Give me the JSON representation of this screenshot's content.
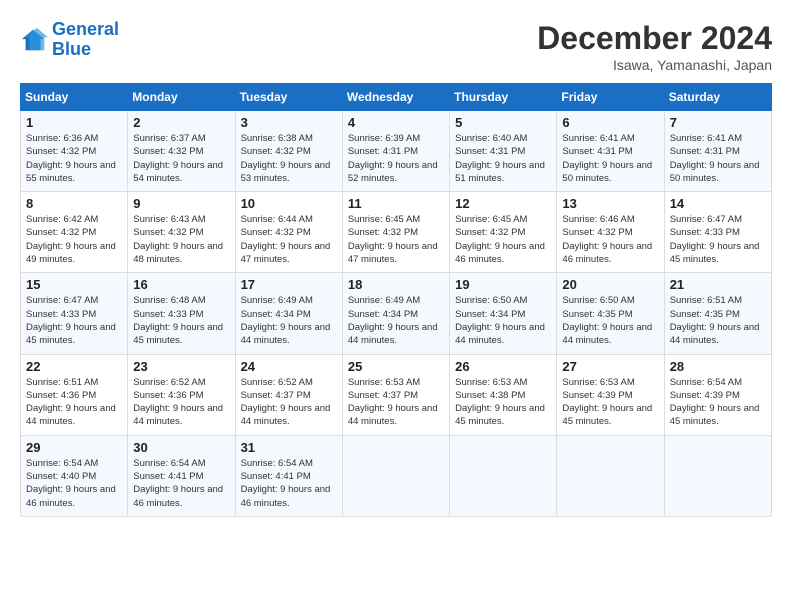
{
  "header": {
    "logo_line1": "General",
    "logo_line2": "Blue",
    "month": "December 2024",
    "location": "Isawa, Yamanashi, Japan"
  },
  "weekdays": [
    "Sunday",
    "Monday",
    "Tuesday",
    "Wednesday",
    "Thursday",
    "Friday",
    "Saturday"
  ],
  "weeks": [
    [
      {
        "day": "1",
        "sunrise": "6:36 AM",
        "sunset": "4:32 PM",
        "daylight": "9 hours and 55 minutes."
      },
      {
        "day": "2",
        "sunrise": "6:37 AM",
        "sunset": "4:32 PM",
        "daylight": "9 hours and 54 minutes."
      },
      {
        "day": "3",
        "sunrise": "6:38 AM",
        "sunset": "4:32 PM",
        "daylight": "9 hours and 53 minutes."
      },
      {
        "day": "4",
        "sunrise": "6:39 AM",
        "sunset": "4:31 PM",
        "daylight": "9 hours and 52 minutes."
      },
      {
        "day": "5",
        "sunrise": "6:40 AM",
        "sunset": "4:31 PM",
        "daylight": "9 hours and 51 minutes."
      },
      {
        "day": "6",
        "sunrise": "6:41 AM",
        "sunset": "4:31 PM",
        "daylight": "9 hours and 50 minutes."
      },
      {
        "day": "7",
        "sunrise": "6:41 AM",
        "sunset": "4:31 PM",
        "daylight": "9 hours and 50 minutes."
      }
    ],
    [
      {
        "day": "8",
        "sunrise": "6:42 AM",
        "sunset": "4:32 PM",
        "daylight": "9 hours and 49 minutes."
      },
      {
        "day": "9",
        "sunrise": "6:43 AM",
        "sunset": "4:32 PM",
        "daylight": "9 hours and 48 minutes."
      },
      {
        "day": "10",
        "sunrise": "6:44 AM",
        "sunset": "4:32 PM",
        "daylight": "9 hours and 47 minutes."
      },
      {
        "day": "11",
        "sunrise": "6:45 AM",
        "sunset": "4:32 PM",
        "daylight": "9 hours and 47 minutes."
      },
      {
        "day": "12",
        "sunrise": "6:45 AM",
        "sunset": "4:32 PM",
        "daylight": "9 hours and 46 minutes."
      },
      {
        "day": "13",
        "sunrise": "6:46 AM",
        "sunset": "4:32 PM",
        "daylight": "9 hours and 46 minutes."
      },
      {
        "day": "14",
        "sunrise": "6:47 AM",
        "sunset": "4:33 PM",
        "daylight": "9 hours and 45 minutes."
      }
    ],
    [
      {
        "day": "15",
        "sunrise": "6:47 AM",
        "sunset": "4:33 PM",
        "daylight": "9 hours and 45 minutes."
      },
      {
        "day": "16",
        "sunrise": "6:48 AM",
        "sunset": "4:33 PM",
        "daylight": "9 hours and 45 minutes."
      },
      {
        "day": "17",
        "sunrise": "6:49 AM",
        "sunset": "4:34 PM",
        "daylight": "9 hours and 44 minutes."
      },
      {
        "day": "18",
        "sunrise": "6:49 AM",
        "sunset": "4:34 PM",
        "daylight": "9 hours and 44 minutes."
      },
      {
        "day": "19",
        "sunrise": "6:50 AM",
        "sunset": "4:34 PM",
        "daylight": "9 hours and 44 minutes."
      },
      {
        "day": "20",
        "sunrise": "6:50 AM",
        "sunset": "4:35 PM",
        "daylight": "9 hours and 44 minutes."
      },
      {
        "day": "21",
        "sunrise": "6:51 AM",
        "sunset": "4:35 PM",
        "daylight": "9 hours and 44 minutes."
      }
    ],
    [
      {
        "day": "22",
        "sunrise": "6:51 AM",
        "sunset": "4:36 PM",
        "daylight": "9 hours and 44 minutes."
      },
      {
        "day": "23",
        "sunrise": "6:52 AM",
        "sunset": "4:36 PM",
        "daylight": "9 hours and 44 minutes."
      },
      {
        "day": "24",
        "sunrise": "6:52 AM",
        "sunset": "4:37 PM",
        "daylight": "9 hours and 44 minutes."
      },
      {
        "day": "25",
        "sunrise": "6:53 AM",
        "sunset": "4:37 PM",
        "daylight": "9 hours and 44 minutes."
      },
      {
        "day": "26",
        "sunrise": "6:53 AM",
        "sunset": "4:38 PM",
        "daylight": "9 hours and 45 minutes."
      },
      {
        "day": "27",
        "sunrise": "6:53 AM",
        "sunset": "4:39 PM",
        "daylight": "9 hours and 45 minutes."
      },
      {
        "day": "28",
        "sunrise": "6:54 AM",
        "sunset": "4:39 PM",
        "daylight": "9 hours and 45 minutes."
      }
    ],
    [
      {
        "day": "29",
        "sunrise": "6:54 AM",
        "sunset": "4:40 PM",
        "daylight": "9 hours and 46 minutes."
      },
      {
        "day": "30",
        "sunrise": "6:54 AM",
        "sunset": "4:41 PM",
        "daylight": "9 hours and 46 minutes."
      },
      {
        "day": "31",
        "sunrise": "6:54 AM",
        "sunset": "4:41 PM",
        "daylight": "9 hours and 46 minutes."
      },
      null,
      null,
      null,
      null
    ]
  ]
}
